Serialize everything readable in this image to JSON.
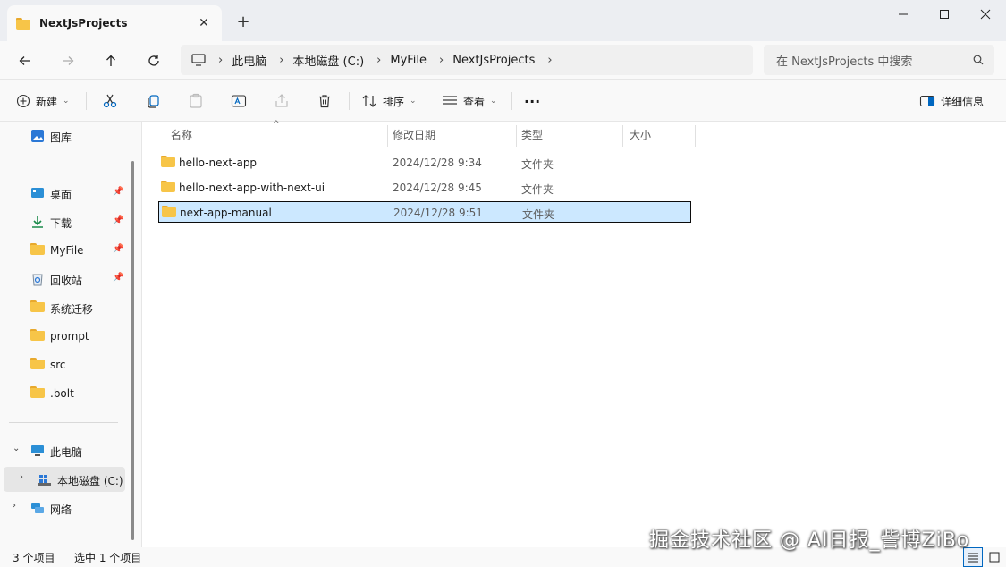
{
  "window": {
    "tab_title": "NextJsProjects",
    "tab_close": "✕",
    "new_tab": "+",
    "minimize": "—",
    "maximize": "☐",
    "close": "✕"
  },
  "nav": {
    "back_icon": "arrow-left-icon",
    "forward_icon": "arrow-right-icon",
    "up_icon": "arrow-up-icon",
    "refresh_icon": "refresh-icon"
  },
  "breadcrumb": {
    "separator": "›",
    "items": [
      "此电脑",
      "本地磁盘 (C:)",
      "MyFile",
      "NextJsProjects"
    ]
  },
  "search": {
    "placeholder": "在 NextJsProjects 中搜索"
  },
  "toolbar": {
    "new_label": "新建",
    "sort_label": "排序",
    "view_label": "查看",
    "more_label": "···",
    "details_label": "详细信息",
    "caret": "⌄"
  },
  "sidebar": {
    "gallery": "图库",
    "pinned": [
      {
        "label": "桌面",
        "icon": "desktop-icon",
        "pinned": true
      },
      {
        "label": "下载",
        "icon": "download-icon",
        "pinned": true
      },
      {
        "label": "MyFile",
        "icon": "folder-icon",
        "pinned": true
      },
      {
        "label": "回收站",
        "icon": "recycle-bin-icon",
        "pinned": true
      },
      {
        "label": "系统迁移",
        "icon": "folder-icon",
        "pinned": false
      },
      {
        "label": "prompt",
        "icon": "folder-icon",
        "pinned": false
      },
      {
        "label": "src",
        "icon": "folder-icon",
        "pinned": false
      },
      {
        "label": ".bolt",
        "icon": "folder-icon",
        "pinned": false
      }
    ],
    "pin_glyph": "📌",
    "this_pc": "此电脑",
    "local_disk": "本地磁盘 (C:)",
    "network": "网络",
    "expanded_arrow": "⌄",
    "collapsed_arrow": "›"
  },
  "columns": {
    "name": "名称",
    "modified": "修改日期",
    "type": "类型",
    "size": "大小"
  },
  "files": [
    {
      "name": "hello-next-app",
      "modified": "2024/12/28 9:34",
      "type": "文件夹",
      "selected": false
    },
    {
      "name": "hello-next-app-with-next-ui",
      "modified": "2024/12/28 9:45",
      "type": "文件夹",
      "selected": false
    },
    {
      "name": "next-app-manual",
      "modified": "2024/12/28 9:51",
      "type": "文件夹",
      "selected": true
    }
  ],
  "status": {
    "item_count": "3 个项目",
    "selected_count": "选中 1 个项目"
  },
  "watermark": "掘金技术社区 @ AI日报_訾博ZiBo",
  "colors": {
    "accent": "#0067c0",
    "selection": "#cce8ff",
    "folder": "#f7c548"
  }
}
